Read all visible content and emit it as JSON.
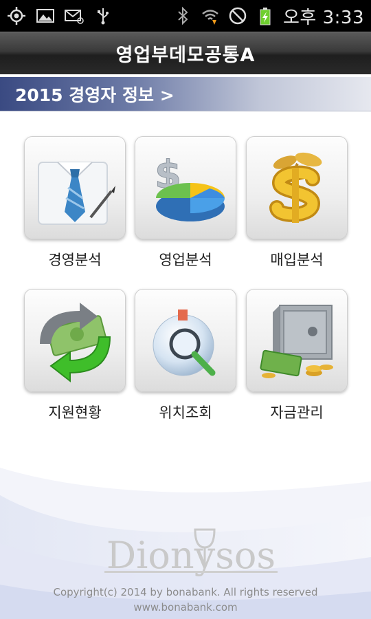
{
  "status_bar": {
    "time": "오후 3:33",
    "left_icons": [
      "gps-icon",
      "image-icon",
      "email-icon",
      "usb-icon"
    ],
    "right_icons": [
      "bluetooth-icon",
      "wifi-icon",
      "no-signal-icon",
      "battery-charging-icon"
    ]
  },
  "title_bar": {
    "title": "영업부데모공통A"
  },
  "section": {
    "title": "2015 경영자 정보 >"
  },
  "menu": [
    {
      "label": "경영분석",
      "icon": "business-shirt-tie-icon"
    },
    {
      "label": "영업분석",
      "icon": "dollar-pie-chart-icon"
    },
    {
      "label": "매입분석",
      "icon": "gold-dollar-sprout-icon"
    },
    {
      "label": "지원현황",
      "icon": "money-arrows-icon"
    },
    {
      "label": "위치조회",
      "icon": "globe-magnifier-icon"
    },
    {
      "label": "자금관리",
      "icon": "safe-money-icon"
    }
  ],
  "footer": {
    "logo_text": "Dionysos",
    "copyright": "Copyright(c) 2014 by bonabank. All rights reserved",
    "website": "www.bonabank.com"
  },
  "colors": {
    "title_bar": "#2a2a2a",
    "section_header": "#4a5890",
    "label_text": "#222222"
  }
}
